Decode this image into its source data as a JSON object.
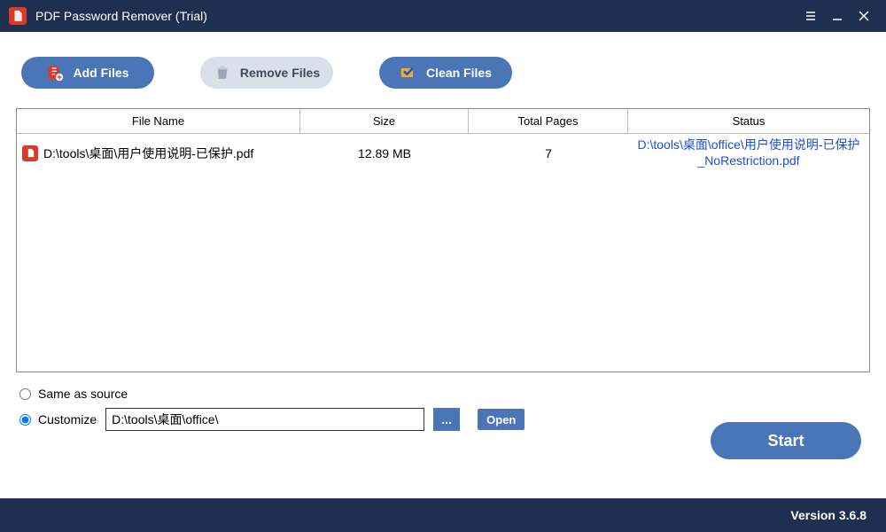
{
  "window": {
    "title": "PDF Password Remover (Trial)"
  },
  "toolbar": {
    "add_label": "Add Files",
    "remove_label": "Remove Files",
    "clean_label": "Clean Files"
  },
  "table": {
    "headers": {
      "file": "File Name",
      "size": "Size",
      "pages": "Total Pages",
      "status": "Status"
    },
    "rows": [
      {
        "file": "D:\\tools\\桌面\\用户使用说明-已保护.pdf",
        "size": "12.89 MB",
        "pages": "7",
        "status": "D:\\tools\\桌面\\office\\用户使用说明-已保护_NoRestriction.pdf"
      }
    ]
  },
  "output": {
    "same_label": "Same as source",
    "customize_label": "Customize",
    "path": "D:\\tools\\桌面\\office\\",
    "browse_label": "...",
    "open_label": "Open",
    "selected": "customize"
  },
  "actions": {
    "start_label": "Start"
  },
  "statusbar": {
    "version": "Version 3.6.8"
  }
}
